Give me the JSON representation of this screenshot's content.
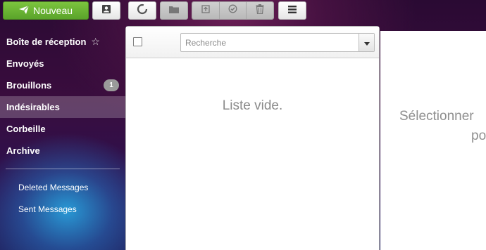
{
  "toolbar": {
    "new_label": "Nouveau",
    "icons": [
      "send-icon",
      "contacts-icon",
      "refresh-icon",
      "folder-icon",
      "archive-icon",
      "check-icon",
      "trash-icon",
      "menu-icon"
    ]
  },
  "sidebar": {
    "folders": [
      {
        "label": "Boîte de réception",
        "icon": "star-icon"
      },
      {
        "label": "Envoyés"
      },
      {
        "label": "Brouillons",
        "badge": "1"
      },
      {
        "label": "Indésirables",
        "active": true
      },
      {
        "label": "Corbeille"
      },
      {
        "label": "Archive"
      }
    ],
    "subfolders": [
      {
        "label": "Deleted Messages"
      },
      {
        "label": "Sent Messages"
      }
    ]
  },
  "message_list": {
    "search_placeholder": "Recherche",
    "empty_text": "Liste vide."
  },
  "preview": {
    "line1": "Sélectionner",
    "line2": "po"
  },
  "colors": {
    "new_button": "#6fb836",
    "active_folder": "rgba(255,255,255,0.22)",
    "badge": "#9a9a9a",
    "muted_text": "#8a8a8a"
  }
}
